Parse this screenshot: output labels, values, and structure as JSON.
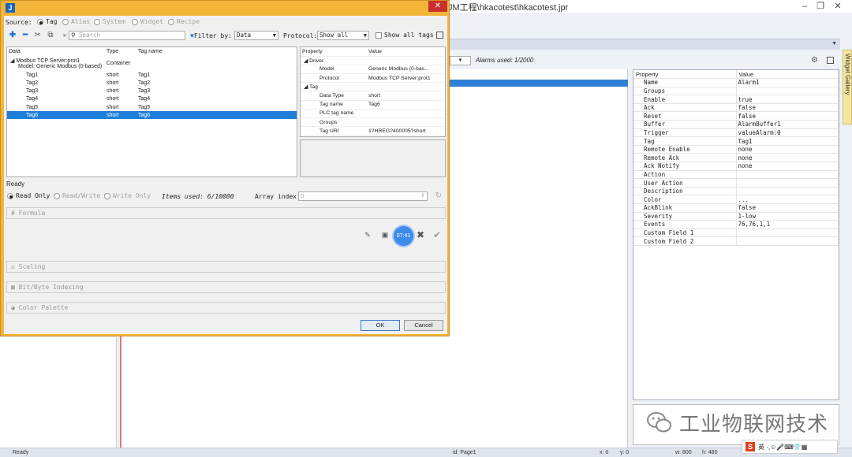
{
  "main_window": {
    "title": "JM工程\\hkacotest\\hkacotest.jpr",
    "alarm_combo_value": "",
    "alarms_used": "Alarms used: 1/2000",
    "widget_gallery": "Widget Gallery",
    "status": {
      "ready": "Ready",
      "id": "id: Page1",
      "x": "x: 0",
      "y": "y: 0",
      "w": "w: 800",
      "h": "h: 480",
      "zoom": ""
    }
  },
  "property_panel": {
    "headers": [
      "Property",
      "Value"
    ],
    "rows": [
      [
        "Name",
        "Alarm1"
      ],
      [
        "Groups",
        ""
      ],
      [
        "Enable",
        "true"
      ],
      [
        "Ack",
        "false"
      ],
      [
        "Reset",
        "false"
      ],
      [
        "Buffer",
        "AlarmBuffer1"
      ],
      [
        "Trigger",
        "valueAlarm:0"
      ],
      [
        "Tag",
        "Tag1"
      ],
      [
        "Remote Enable",
        "none"
      ],
      [
        "Remote Ack",
        "none"
      ],
      [
        "Ack Notify",
        "none"
      ],
      [
        "Action",
        ""
      ],
      [
        "User Action",
        ""
      ],
      [
        "Description",
        ""
      ],
      [
        "Color",
        "..."
      ],
      [
        "AckBlink",
        "false"
      ],
      [
        "Severity",
        "1-low"
      ],
      [
        "Events",
        "76,76,1,1"
      ],
      [
        "Custom Field 1",
        ""
      ],
      [
        "Custom Field 2",
        ""
      ]
    ]
  },
  "watermark": {
    "text": "工业物联网技术"
  },
  "ime": {
    "label": "英"
  },
  "dialog": {
    "icon_letter": "J",
    "source": {
      "label": "Source:",
      "options": [
        "Tag",
        "Alias",
        "System",
        "Widget",
        "Recipe"
      ],
      "selected": "Tag"
    },
    "toolbar": {
      "search_placeholder": "Search",
      "filter_label": "Filter by:",
      "filter_value": "Data",
      "protocol_label": "Protocol:",
      "protocol_value": "Show all",
      "show_all_tags": "Show all tags"
    },
    "tag_tree": {
      "headers": [
        "Data",
        "Type",
        "Tag name"
      ],
      "root": {
        "line1": "Modbus TCP Server:prot1",
        "line2": "Model: Generic Modbus (0-based)",
        "type": "Container"
      },
      "rows": [
        [
          "Tag1",
          "short",
          "Tag1"
        ],
        [
          "Tag2",
          "short",
          "Tag2"
        ],
        [
          "Tag3",
          "short",
          "Tag3"
        ],
        [
          "Tag4",
          "short",
          "Tag4"
        ],
        [
          "Tag5",
          "short",
          "Tag5"
        ],
        [
          "Tag6",
          "short",
          "Tag6"
        ]
      ],
      "selected": "Tag6"
    },
    "prop_tree": {
      "headers": [
        "Property",
        "Value"
      ],
      "groups": [
        {
          "name": "Driver",
          "rows": [
            [
              "Model",
              "Generic Modbus (0-bas..."
            ],
            [
              "Protocol",
              "Modbus TCP Server:prot1"
            ]
          ]
        },
        {
          "name": "Tag",
          "rows": [
            [
              "Data Type",
              "short"
            ],
            [
              "Tag name",
              "Tag6"
            ],
            [
              "PLC tag name",
              ""
            ],
            [
              "Groups",
              ""
            ],
            [
              "Tag URI",
              "1?HREG?400005?short"
            ]
          ]
        }
      ]
    },
    "status": "Ready",
    "access": {
      "options": [
        "Read Only",
        "Read/Write",
        "Write Only"
      ],
      "selected": "Read Only"
    },
    "items_used": "Items used: 6/10000",
    "array_index_label": "Array index",
    "array_index_value": "0",
    "sections": [
      "Formula",
      "Scaling",
      "Bit/Byte Indexing",
      "Color Palette"
    ],
    "timer": "07:41",
    "buttons": {
      "ok": "OK",
      "cancel": "Cancel"
    }
  }
}
